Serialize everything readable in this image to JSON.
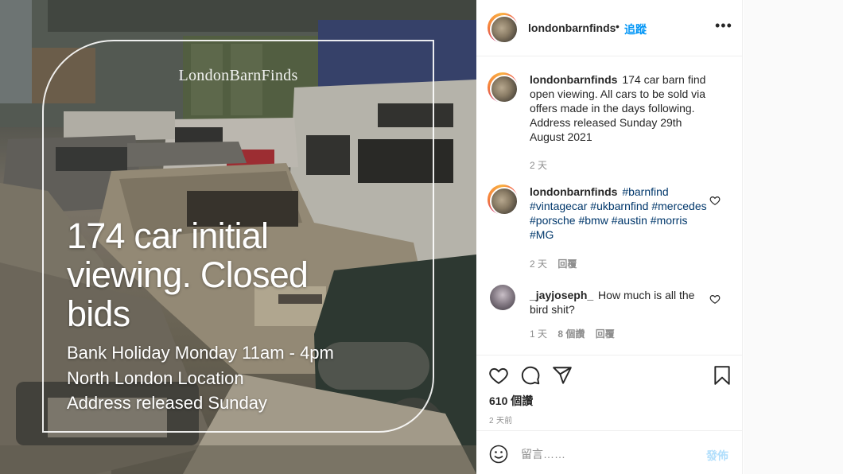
{
  "photo": {
    "brand": "LondonBarnFinds",
    "headline": [
      "174 car initial",
      "viewing. Closed",
      "bids"
    ],
    "details": [
      "Bank Holiday Monday 11am - 4pm",
      "North London Location",
      "Address released Sunday"
    ]
  },
  "header": {
    "username": "londonbarnfinds",
    "separator": "•",
    "follow_label": "追蹤",
    "more_label": "•••"
  },
  "caption": {
    "username": "londonbarnfinds",
    "text": "174 car barn find open viewing. All cars to be sold via offers made in the days following. Address released Sunday 29th August 2021",
    "age": "2 天"
  },
  "comments": [
    {
      "username": "londonbarnfinds",
      "tags": [
        "#barnfind",
        "#vintagecar",
        "#ukbarnfind",
        "#mercedes",
        "#porsche",
        "#bmw",
        "#austin",
        "#morris",
        "#MG"
      ],
      "age": "2 天",
      "reply_label": "回覆"
    },
    {
      "username": "_jayjoseph_",
      "text": "How much is all the bird shit?",
      "age": "1 天",
      "likes": "8 個讚",
      "reply_label": "回覆"
    }
  ],
  "actions": {
    "likes": "610 個讚",
    "time": "2 天前"
  },
  "add_comment": {
    "placeholder": "留言……",
    "post_label": "發佈"
  },
  "colors": {
    "link_blue": "#0095f6",
    "post_disabled": "#b2dffc",
    "hashtag": "#00376b",
    "muted": "#8e8e8e"
  }
}
